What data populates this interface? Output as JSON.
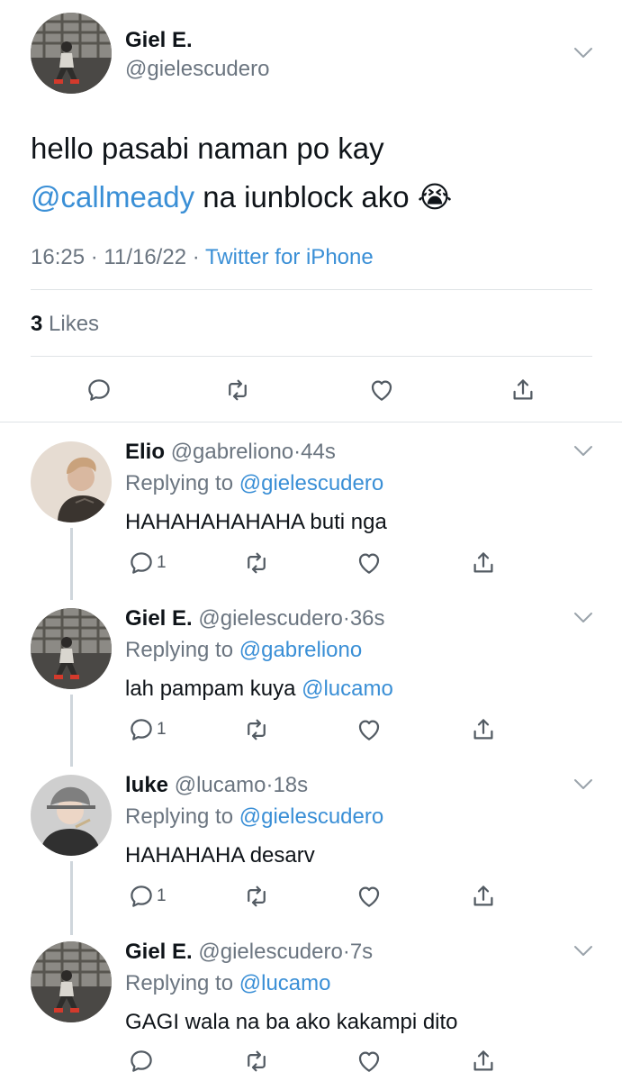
{
  "colors": {
    "accent": "#3a8fd6",
    "muted": "#6b7580",
    "text": "#0f1419",
    "separator": "#dfe3e6"
  },
  "main_tweet": {
    "name": "Giel E.",
    "handle": "@gielescudero",
    "text_line1": "hello pasabi naman po kay",
    "mention": "@callmeady",
    "text_line2_rest": "na iunblock ako",
    "emoji": "😭",
    "time": "16:25",
    "date": "11/16/22",
    "source": "Twitter for iPhone",
    "dot": "·",
    "likes_count": "3",
    "likes_label": "Likes"
  },
  "replies": [
    {
      "name": "Elio",
      "handle": "@gabreliono",
      "dot": "·",
      "age": "44s",
      "replying_label": "Replying to",
      "replying_to": "@gielescudero",
      "text": "HAHAHAHAHAHA buti nga",
      "mention": "",
      "reply_count": "1",
      "avatar": "elio-avatar"
    },
    {
      "name": "Giel E.",
      "handle": "@gielescudero",
      "dot": "·",
      "age": "36s",
      "replying_label": "Replying to",
      "replying_to": "@gabreliono",
      "text": "lah pampam kuya",
      "mention": "@lucamo",
      "reply_count": "1",
      "avatar": "giel-avatar"
    },
    {
      "name": "luke",
      "handle": "@lucamo",
      "dot": "·",
      "age": "18s",
      "replying_label": "Replying to",
      "replying_to": "@gielescudero",
      "text": "HAHAHAHA desarv",
      "mention": "",
      "reply_count": "1",
      "avatar": "luke-avatar"
    },
    {
      "name": "Giel E.",
      "handle": "@gielescudero",
      "dot": "·",
      "age": "7s",
      "replying_label": "Replying to",
      "replying_to": "@lucamo",
      "text": "GAGI wala na ba ako kakampi dito",
      "mention": "",
      "reply_count": "",
      "avatar": "giel-avatar"
    }
  ]
}
